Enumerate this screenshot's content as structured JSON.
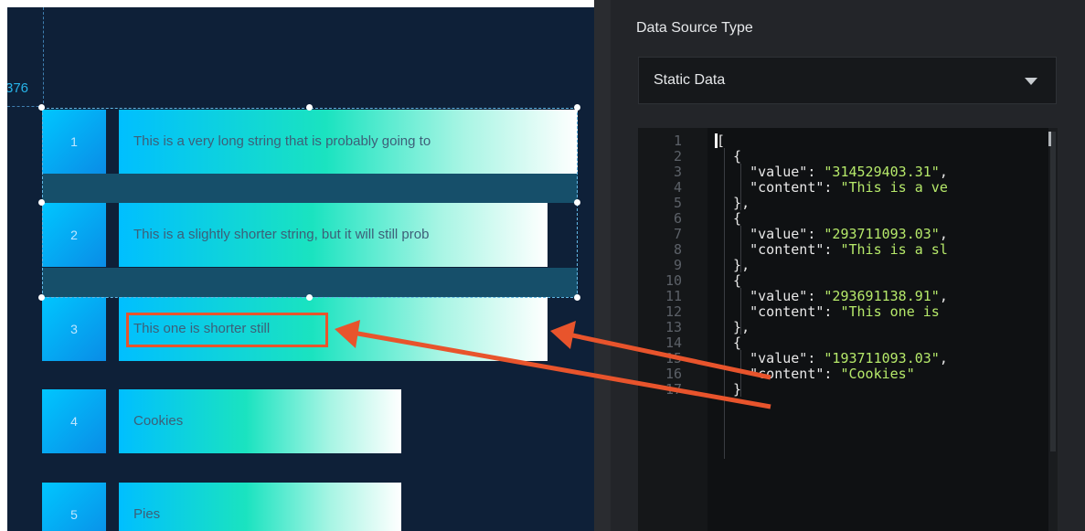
{
  "canvas": {
    "coordinate_readout": "376",
    "accent": "#0e2038"
  },
  "ranking": {
    "rows": [
      {
        "rank": "1",
        "content": "This is a very long string that is probably going to"
      },
      {
        "rank": "2",
        "content": "This is a slightly shorter string, but it will still prob"
      },
      {
        "rank": "3",
        "content": "This one is shorter still"
      },
      {
        "rank": "4",
        "content": "Cookies"
      },
      {
        "rank": "5",
        "content": "Pies"
      }
    ]
  },
  "panel": {
    "title": "Data Source Type",
    "select_value": "Static Data"
  },
  "editor": {
    "line_numbers": [
      "1",
      "2",
      "3",
      "4",
      "5",
      "6",
      "7",
      "8",
      "9",
      "10",
      "11",
      "12",
      "13",
      "14",
      "15",
      "16",
      "17"
    ],
    "lines": [
      {
        "tokens": [
          {
            "t": "punc",
            "v": "["
          }
        ]
      },
      {
        "tokens": [
          {
            "t": "punc",
            "v": "  {"
          }
        ]
      },
      {
        "tokens": [
          {
            "t": "key",
            "v": "    \"value\": "
          },
          {
            "t": "str",
            "v": "\"314529403.31\""
          },
          {
            "t": "punc",
            "v": ","
          }
        ]
      },
      {
        "tokens": [
          {
            "t": "key",
            "v": "    \"content\": "
          },
          {
            "t": "str",
            "v": "\"This is a ve"
          }
        ]
      },
      {
        "tokens": [
          {
            "t": "punc",
            "v": "  },"
          }
        ]
      },
      {
        "tokens": [
          {
            "t": "punc",
            "v": "  {"
          }
        ]
      },
      {
        "tokens": [
          {
            "t": "key",
            "v": "    \"value\": "
          },
          {
            "t": "str",
            "v": "\"293711093.03\""
          },
          {
            "t": "punc",
            "v": ","
          }
        ]
      },
      {
        "tokens": [
          {
            "t": "key",
            "v": "    \"content\": "
          },
          {
            "t": "str",
            "v": "\"This is a sl"
          }
        ]
      },
      {
        "tokens": [
          {
            "t": "punc",
            "v": "  },"
          }
        ]
      },
      {
        "tokens": [
          {
            "t": "punc",
            "v": "  {"
          }
        ]
      },
      {
        "tokens": [
          {
            "t": "key",
            "v": "    \"value\": "
          },
          {
            "t": "str",
            "v": "\"293691138.91\""
          },
          {
            "t": "punc",
            "v": ","
          }
        ]
      },
      {
        "tokens": [
          {
            "t": "key",
            "v": "    \"content\": "
          },
          {
            "t": "str",
            "v": "\"This one is"
          }
        ]
      },
      {
        "tokens": [
          {
            "t": "punc",
            "v": "  },"
          }
        ]
      },
      {
        "tokens": [
          {
            "t": "punc",
            "v": "  {"
          }
        ]
      },
      {
        "tokens": [
          {
            "t": "key",
            "v": "    \"value\": "
          },
          {
            "t": "str",
            "v": "\"193711093.03\""
          },
          {
            "t": "punc",
            "v": ","
          }
        ]
      },
      {
        "tokens": [
          {
            "t": "key",
            "v": "    \"content\": "
          },
          {
            "t": "str",
            "v": "\"Cookies\""
          }
        ]
      },
      {
        "tokens": [
          {
            "t": "punc",
            "v": "  }"
          }
        ]
      }
    ]
  },
  "annotation": {
    "color": "#e8542c"
  }
}
